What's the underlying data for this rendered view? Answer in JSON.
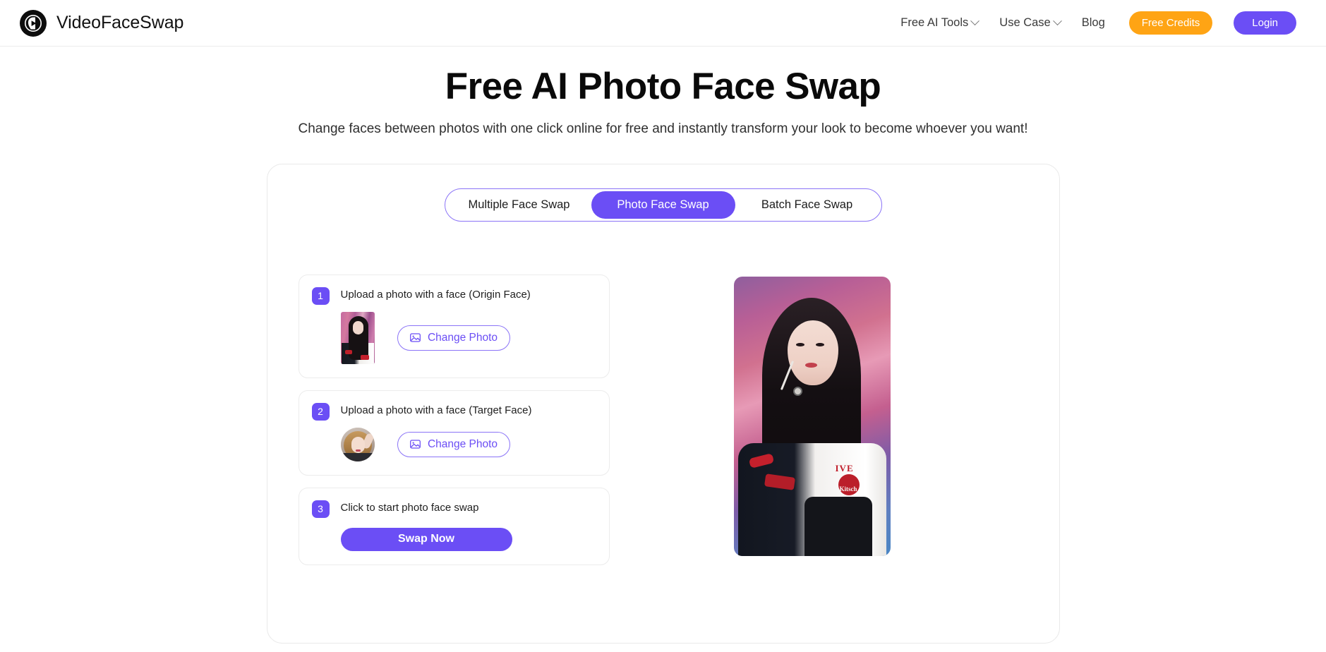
{
  "header": {
    "brand_name": "VideoFaceSwap",
    "logo_icon": "face-play-logo-icon",
    "nav": [
      {
        "label": "Free AI Tools",
        "has_dropdown": true
      },
      {
        "label": "Use Case",
        "has_dropdown": true
      },
      {
        "label": "Blog",
        "has_dropdown": false
      }
    ],
    "credits_button": "Free Credits",
    "login_button": "Login",
    "credits_color": "#ffa414",
    "login_color": "#6b4ef5"
  },
  "hero": {
    "title": "Free AI Photo Face Swap",
    "subtitle": "Change faces between photos with one click online for free and instantly transform your look to become whoever you want!"
  },
  "tabs": {
    "items": [
      {
        "label": "Multiple Face Swap",
        "active": false
      },
      {
        "label": "Photo Face Swap",
        "active": true
      },
      {
        "label": "Batch Face Swap",
        "active": false
      }
    ],
    "active_color": "#6b4ef5",
    "border_color": "#8b74f7"
  },
  "steps": [
    {
      "number": "1",
      "label": "Upload a photo with a face  (Origin Face)",
      "thumbnail": "origin-face-thumbnail",
      "thumbnail_shape": "rectangle",
      "button_label": "Change Photo",
      "button_icon": "image-icon"
    },
    {
      "number": "2",
      "label": "Upload a photo with a face  (Target Face)",
      "thumbnail": "target-face-thumbnail",
      "thumbnail_shape": "circle",
      "button_label": "Change Photo",
      "button_icon": "image-icon"
    },
    {
      "number": "3",
      "label": "Click to start photo face swap",
      "button_label": "Swap Now"
    }
  ],
  "preview": {
    "name": "result-preview-image",
    "alt": "Performer with long black hair in a varsity jacket on a pink stage",
    "jacket_text_primary": "IVE",
    "jacket_text_secondary": "Kitsch"
  }
}
